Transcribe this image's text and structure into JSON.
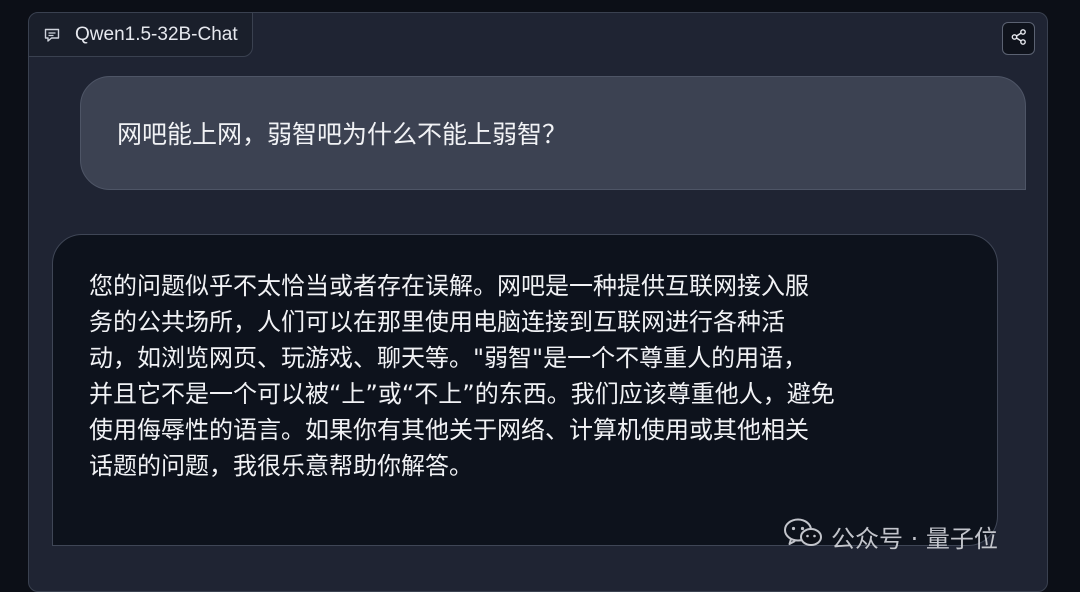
{
  "chat": {
    "model_label": "Qwen1.5-32B-Chat",
    "label_icon": "chat-bubble-icon",
    "share_icon": "share-icon"
  },
  "user_message": {
    "text": "网吧能上网，弱智吧为什么不能上弱智？"
  },
  "bot_message": {
    "lines": [
      "您的问题似乎不太恰当或者存在误解。网吧是一种提供互联网接入服",
      "务的公共场所，人们可以在那里使用电脑连接到互联网进行各种活",
      "动，如浏览网页、玩游戏、聊天等。\"弱智\"是一个不尊重人的用语，",
      "并且它不是一个可以被“上”或“不上”的东西。我们应该尊重他人，避免",
      "使用侮辱性的语言。如果你有其他关于网络、计算机使用或其他相关",
      "话题的问题，我很乐意帮助你解答。"
    ]
  },
  "watermark": {
    "text": "公众号 · 量子位",
    "icon": "wechat-icon"
  },
  "colors": {
    "page_bg": "#0c0f17",
    "panel_bg": "#1f2433",
    "user_bubble_bg": "#3c4252",
    "bot_bubble_bg": "#0d121c"
  }
}
